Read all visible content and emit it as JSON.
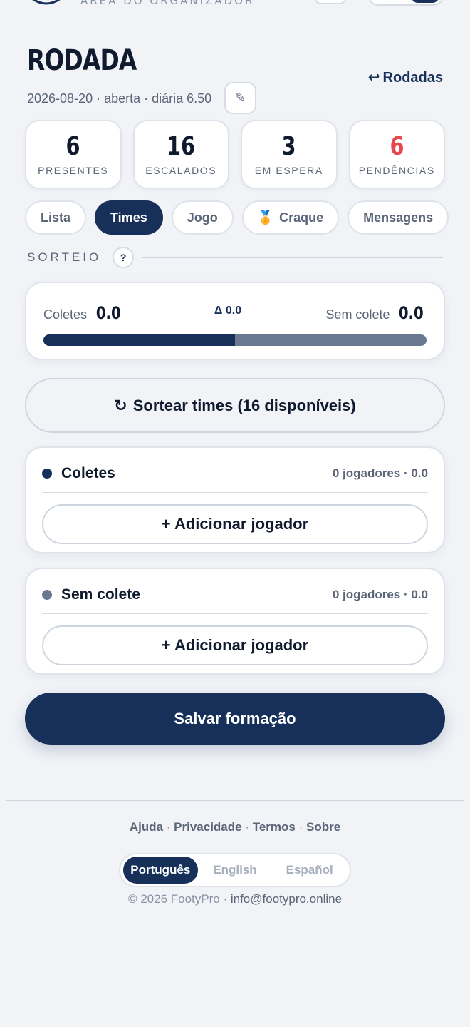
{
  "header": {
    "org_label": "ÁREA DO ORGANIZADOR",
    "title": "RODADA",
    "back_link": "Rodadas",
    "meta": "2026-08-20 · aberta · diária 6.50"
  },
  "stats": [
    {
      "value": "6",
      "label": "PRESENTES"
    },
    {
      "value": "16",
      "label": "ESCALADOS"
    },
    {
      "value": "3",
      "label": "EM ESPERA"
    },
    {
      "value": "6",
      "label": "PENDÊNCIAS",
      "color": "#e5484d"
    }
  ],
  "tabs": [
    {
      "label": "Lista"
    },
    {
      "label": "Times",
      "active": true
    },
    {
      "label": "Jogo"
    },
    {
      "label": "Craque",
      "icon": "medal-icon"
    },
    {
      "label": "Mensagens"
    }
  ],
  "sorteio": {
    "label": "SORTEIO",
    "help": "?"
  },
  "balance": {
    "left_label": "Coletes",
    "left_value": "0.0",
    "delta": "Δ 0.0",
    "right_label": "Sem colete",
    "right_value": "0.0",
    "left_share": 0.5
  },
  "shuffle_button": "Sortear times (16 disponíveis)",
  "teams": [
    {
      "name": "Coletes",
      "info": "0 jogadores · 0.0",
      "dot_color": "#17305a",
      "add_label": "+ Adicionar jogador"
    },
    {
      "name": "Sem colete",
      "info": "0 jogadores · 0.0",
      "dot_color": "#6b7891",
      "add_label": "+ Adicionar jogador"
    }
  ],
  "save_button": "Salvar formação",
  "footer": {
    "links": [
      "Ajuda",
      "Privacidade",
      "Termos",
      "Sobre"
    ],
    "languages": [
      {
        "label": "Português",
        "active": true
      },
      {
        "label": "English"
      },
      {
        "label": "Español"
      }
    ],
    "copyright": "© 2026 FootyPro ·",
    "email": "info@footypro.online"
  },
  "colors": {
    "primary": "#17305a",
    "danger": "#e5484d",
    "background": "#f1f3f7"
  }
}
